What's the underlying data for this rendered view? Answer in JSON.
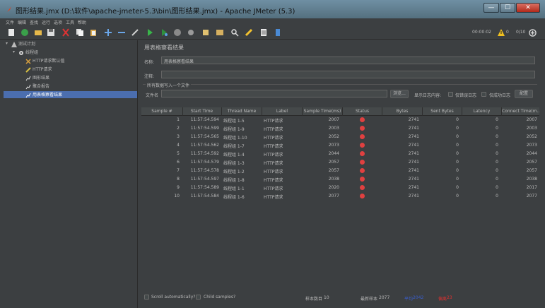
{
  "window": {
    "title": "图形结果.jmx (D:\\软件\\apache-jmeter-5.3\\bin\\图形结果.jmx) - Apache JMeter (5.3)",
    "minimize": "—",
    "maximize": "☐",
    "close": "✕"
  },
  "menu": [
    "文件",
    "编辑",
    "查找",
    "运行",
    "选项",
    "工具",
    "帮助"
  ],
  "toolbar": {
    "elapsed": "00:00:02",
    "warnings": "0",
    "threads": "0/10"
  },
  "tree": {
    "test_plan": "测试计划",
    "thread_group": "线程组",
    "children": [
      "HTTP请求默认值",
      "HTTP请求",
      "图形结果",
      "聚合报告",
      "用表格察看结果"
    ]
  },
  "panel": {
    "title": "用表格察看结果",
    "name_label": "名称:",
    "name_value": "用表格察看结果",
    "comment_label": "注释:",
    "comment_value": "",
    "file_group_title": "所有数据写入一个文件",
    "file_label": "文件名",
    "file_value": "",
    "browse": "浏览...",
    "log_content_label": "显示日志内容:",
    "errors_only": "仅错误日志",
    "success_only": "仅成功日志",
    "configure": "配置"
  },
  "table": {
    "headers": [
      "Sample #",
      "Start Time",
      "Thread Name",
      "Label",
      "Sample Time(ms)",
      "Status",
      "Bytes",
      "Sent Bytes",
      "Latency",
      "Connect Time(m..."
    ],
    "rows": [
      [
        "1",
        "11:57:54.594",
        "线程组 1-5",
        "HTTP请求",
        "2007",
        "2741",
        "0",
        "0",
        "2007"
      ],
      [
        "2",
        "11:57:54.599",
        "线程组 1-9",
        "HTTP请求",
        "2003",
        "2741",
        "0",
        "0",
        "2003"
      ],
      [
        "3",
        "11:57:54.565",
        "线程组 1-10",
        "HTTP请求",
        "2052",
        "2741",
        "0",
        "0",
        "2052"
      ],
      [
        "4",
        "11:57:54.562",
        "线程组 1-7",
        "HTTP请求",
        "2073",
        "2741",
        "0",
        "0",
        "2073"
      ],
      [
        "5",
        "11:57:54.592",
        "线程组 1-4",
        "HTTP请求",
        "2044",
        "2741",
        "0",
        "0",
        "2044"
      ],
      [
        "6",
        "11:57:54.579",
        "线程组 1-3",
        "HTTP请求",
        "2057",
        "2741",
        "0",
        "0",
        "2057"
      ],
      [
        "7",
        "11:57:54.578",
        "线程组 1-2",
        "HTTP请求",
        "2057",
        "2741",
        "0",
        "0",
        "2057"
      ],
      [
        "8",
        "11:57:54.597",
        "线程组 1-8",
        "HTTP请求",
        "2038",
        "2741",
        "0",
        "0",
        "2038"
      ],
      [
        "9",
        "11:57:54.589",
        "线程组 1-1",
        "HTTP请求",
        "2020",
        "2741",
        "0",
        "0",
        "2017"
      ],
      [
        "10",
        "11:57:54.584",
        "线程组 1-6",
        "HTTP请求",
        "2077",
        "2741",
        "0",
        "0",
        "2077"
      ]
    ]
  },
  "footer": {
    "scroll_auto": "Scroll automatically?",
    "child_samples": "Child samples?",
    "sample_count_label": "样本数目",
    "sample_count": "10",
    "latest_sample_label": "最新样本",
    "latest_sample": "2077",
    "average_label": "平均",
    "average": "2042",
    "deviation_label": "偏离",
    "deviation": "23"
  },
  "colors": {
    "background": "#3c3f41",
    "selection": "#4b6eaf",
    "status_error": "#e04040",
    "average": "#3a5fd0",
    "deviation": "#e03030"
  }
}
